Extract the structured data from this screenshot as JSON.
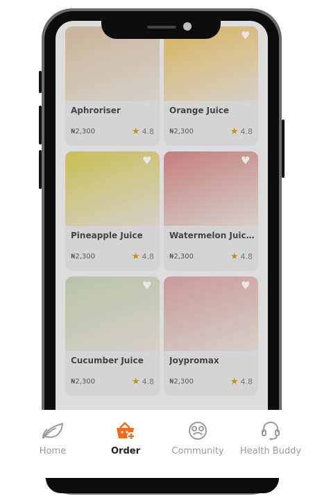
{
  "products": [
    {
      "name": "Aphroriser",
      "price": "₦2,300",
      "rating": "4.8",
      "img_color": "#c9b49a"
    },
    {
      "name": "Orange Juice",
      "price": "₦2,300",
      "rating": "4.8",
      "img_color": "#d9b45e"
    },
    {
      "name": "Pineapple Juice",
      "price": "₦2,300",
      "rating": "4.8",
      "img_color": "#c8bf55"
    },
    {
      "name": "Watermelon Juic...",
      "price": "₦2,300",
      "rating": "4.8",
      "img_color": "#c47e7e"
    },
    {
      "name": "Cucumber Juice",
      "price": "₦2,300",
      "rating": "4.8",
      "img_color": "#b9c3a8"
    },
    {
      "name": "Joypromax",
      "price": "₦2,300",
      "rating": "4.8",
      "img_color": "#c99a98"
    }
  ],
  "nav": {
    "home": {
      "label": "Home",
      "icon": "leaf-icon"
    },
    "order": {
      "label": "Order",
      "icon": "basket-add-icon"
    },
    "community": {
      "label": "Community",
      "icon": "community-face-icon"
    },
    "health_buddy": {
      "label": "Health Buddy",
      "icon": "headset-icon"
    }
  },
  "colors": {
    "accent": "#f36a1f",
    "inactive": "#9a9a9a",
    "star": "#c98f12"
  }
}
